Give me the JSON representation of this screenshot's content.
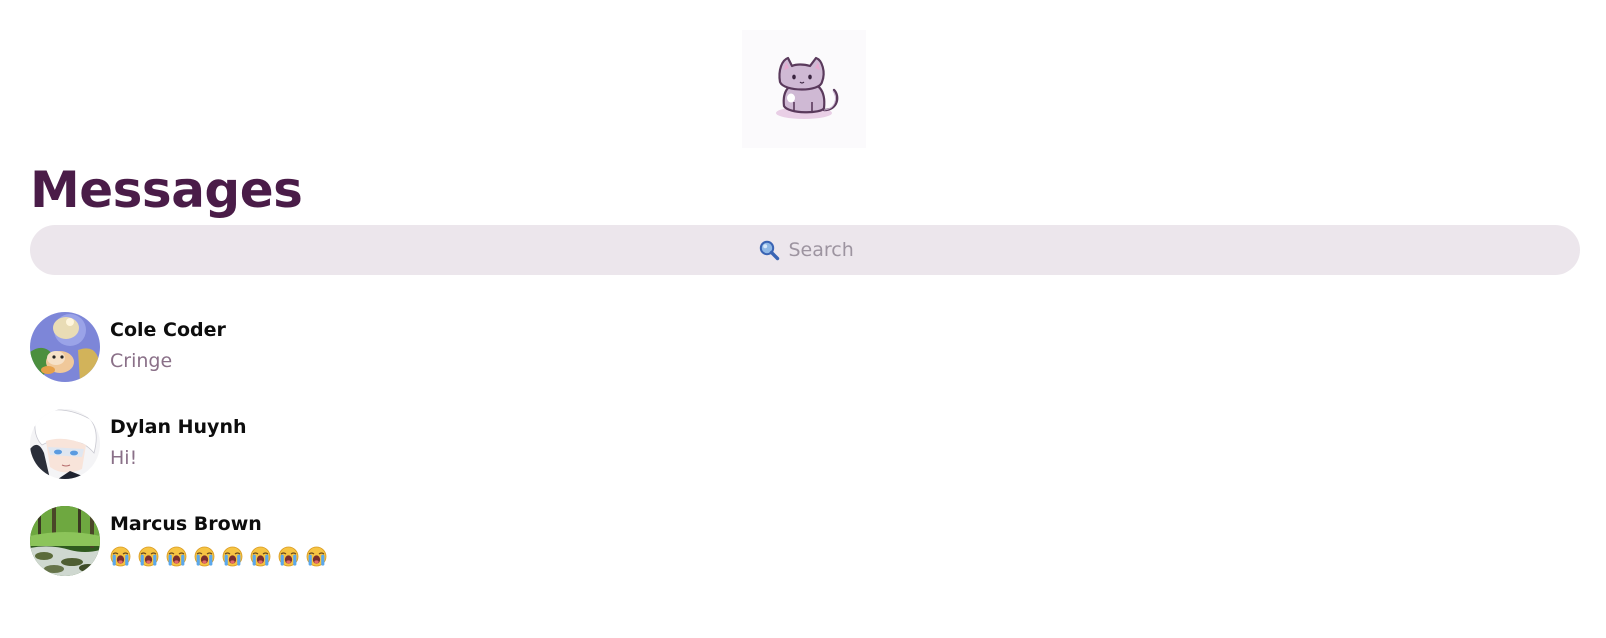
{
  "header": {
    "logo_icon": "cat-mascot-icon",
    "title": "Messages"
  },
  "search": {
    "placeholder": "Search",
    "value": "",
    "icon": "magnifying-glass-icon"
  },
  "colors": {
    "title": "#4a1c48",
    "search_background": "#ece6ec",
    "preview_text": "#8a7088",
    "name_text": "#0d0d0d"
  },
  "conversations": [
    {
      "name": "Cole Coder",
      "last_message": "Cringe",
      "avatar_icon": "toad-character-avatar"
    },
    {
      "name": "Dylan Huynh",
      "last_message": "Hi!",
      "avatar_icon": "anime-character-avatar"
    },
    {
      "name": "Marcus Brown",
      "last_message_emoji": "loudly-crying-face-icon",
      "last_message_emoji_count": 8,
      "avatar_icon": "forest-stream-avatar"
    }
  ]
}
